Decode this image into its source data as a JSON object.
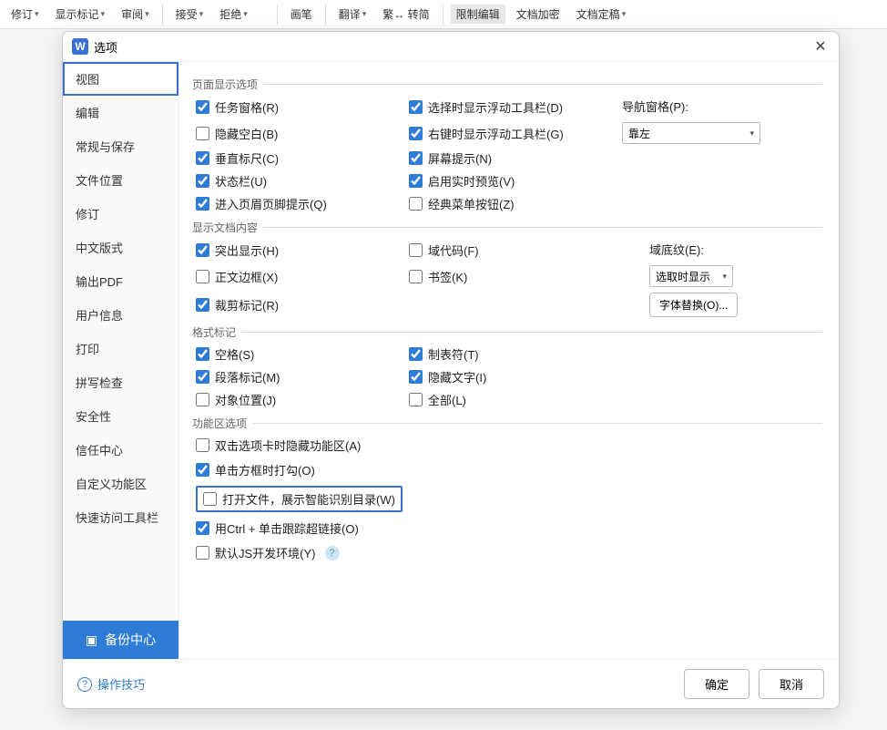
{
  "toolbar": {
    "items": [
      {
        "label": "修订",
        "dropdown": true
      },
      {
        "label": "显示标记",
        "dropdown": true,
        "icon": "page"
      },
      {
        "label": "审阅",
        "dropdown": true,
        "icon": "flag"
      },
      {
        "sep": true
      },
      {
        "label": "接受",
        "dropdown": true
      },
      {
        "label": "拒绝",
        "dropdown": true
      },
      {
        "label": "",
        "icon": "doc"
      },
      {
        "sep": true
      },
      {
        "label": "画笔"
      },
      {
        "sep": true
      },
      {
        "label": "翻译",
        "dropdown": true
      },
      {
        "label": "繁↔ 转简"
      },
      {
        "sep": true
      },
      {
        "label": "限制编辑",
        "hl": true
      },
      {
        "label": "文档加密"
      },
      {
        "label": "文档定稿",
        "dropdown": true
      }
    ]
  },
  "dialog": {
    "title": "选项",
    "sidebar": {
      "items": [
        {
          "label": "视图",
          "active": true
        },
        {
          "label": "编辑"
        },
        {
          "label": "常规与保存"
        },
        {
          "label": "文件位置"
        },
        {
          "label": "修订"
        },
        {
          "label": "中文版式"
        },
        {
          "label": "输出PDF"
        },
        {
          "label": "用户信息"
        },
        {
          "label": "打印"
        },
        {
          "label": "拼写检查"
        },
        {
          "label": "安全性"
        },
        {
          "label": "信任中心"
        },
        {
          "label": "自定义功能区"
        },
        {
          "label": "快速访问工具栏"
        }
      ],
      "backup": "备份中心"
    },
    "sections": {
      "pageDisplay": {
        "title": "页面显示选项",
        "col1": [
          {
            "label": "任务窗格(R)",
            "checked": true
          },
          {
            "label": "隐藏空白(B)",
            "checked": false
          },
          {
            "label": "垂直标尺(C)",
            "checked": true
          },
          {
            "label": "状态栏(U)",
            "checked": true
          },
          {
            "label": "进入页眉页脚提示(Q)",
            "checked": true
          }
        ],
        "col2": [
          {
            "label": "选择时显示浮动工具栏(D)",
            "checked": true
          },
          {
            "label": "右键时显示浮动工具栏(G)",
            "checked": true
          },
          {
            "label": "屏幕提示(N)",
            "checked": true
          },
          {
            "label": "启用实时预览(V)",
            "checked": true
          },
          {
            "label": "经典菜单按钮(Z)",
            "checked": false
          }
        ],
        "navLabel": "导航窗格(P):",
        "navValue": "靠左"
      },
      "docContent": {
        "title": "显示文档内容",
        "col1": [
          {
            "label": "突出显示(H)",
            "checked": true
          },
          {
            "label": "正文边框(X)",
            "checked": false
          },
          {
            "label": "裁剪标记(R)",
            "checked": true
          }
        ],
        "col2": [
          {
            "label": "域代码(F)",
            "checked": false
          },
          {
            "label": "书签(K)",
            "checked": false
          }
        ],
        "shadeLabel": "域底纹(E):",
        "shadeValue": "选取时显示",
        "fontSubBtn": "字体替换(O)..."
      },
      "formatMarks": {
        "title": "格式标记",
        "col1": [
          {
            "label": "空格(S)",
            "checked": true
          },
          {
            "label": "段落标记(M)",
            "checked": true
          },
          {
            "label": "对象位置(J)",
            "checked": false
          }
        ],
        "col2": [
          {
            "label": "制表符(T)",
            "checked": true
          },
          {
            "label": "隐藏文字(I)",
            "checked": true
          },
          {
            "label": "全部(L)",
            "checked": false
          }
        ]
      },
      "ribbonOpts": {
        "title": "功能区选项",
        "items": [
          {
            "label": "双击选项卡时隐藏功能区(A)",
            "checked": false
          },
          {
            "label": "单击方框时打勾(O)",
            "checked": true
          },
          {
            "label": "打开文件，展示智能识别目录(W)",
            "checked": false,
            "boxed": true
          },
          {
            "label": "用Ctrl + 单击跟踪超链接(O)",
            "checked": true
          },
          {
            "label": "默认JS开发环境(Y)",
            "checked": false,
            "help": true
          }
        ]
      }
    },
    "footer": {
      "tips": "操作技巧",
      "ok": "确定",
      "cancel": "取消"
    }
  }
}
